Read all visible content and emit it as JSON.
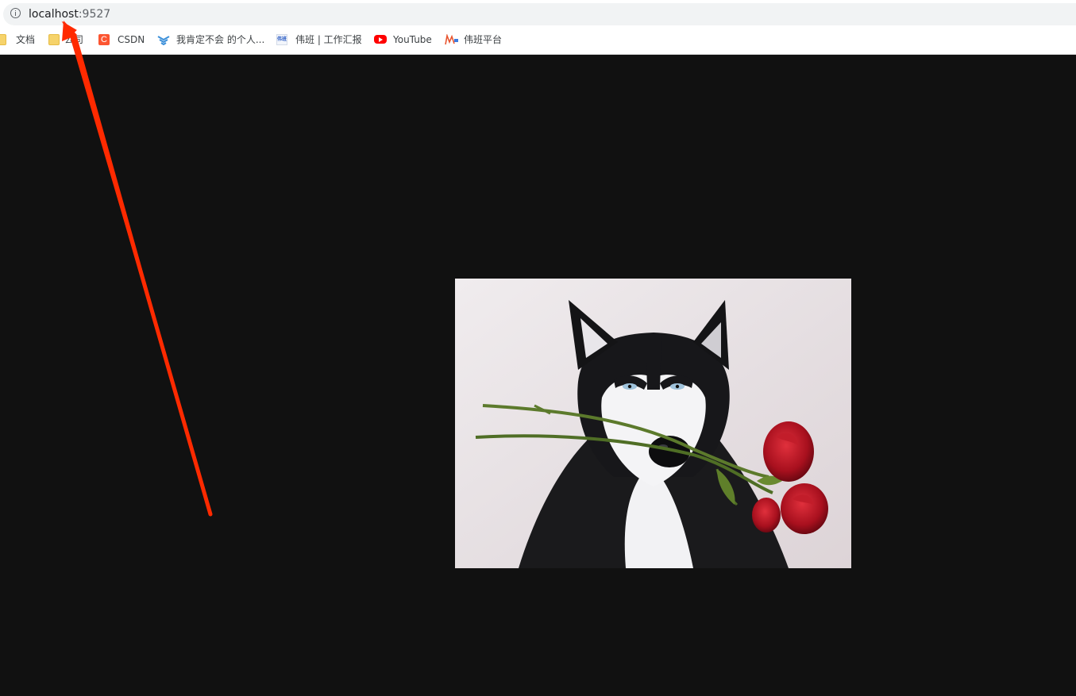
{
  "address_bar": {
    "host": "localhost",
    "port": ":9527"
  },
  "bookmarks": [
    {
      "label": "文档",
      "icon": "folder-icon"
    },
    {
      "label": "公司",
      "icon": "folder-icon"
    },
    {
      "label": "CSDN",
      "icon": "csdn-icon",
      "icon_text": "C"
    },
    {
      "label": "我肯定不会 的个人...",
      "icon": "bookmark-site-icon"
    },
    {
      "label": "伟班 | 工作汇报",
      "icon": "weiban-icon",
      "icon_text": "伟班"
    },
    {
      "label": "YouTube",
      "icon": "youtube-icon"
    },
    {
      "label": "伟班平台",
      "icon": "weiban-platform-icon"
    }
  ],
  "page": {
    "background": "#111111",
    "image": {
      "subject": "husky-with-roses-photo"
    }
  },
  "annotation": {
    "arrow_color": "#ff2a00"
  }
}
